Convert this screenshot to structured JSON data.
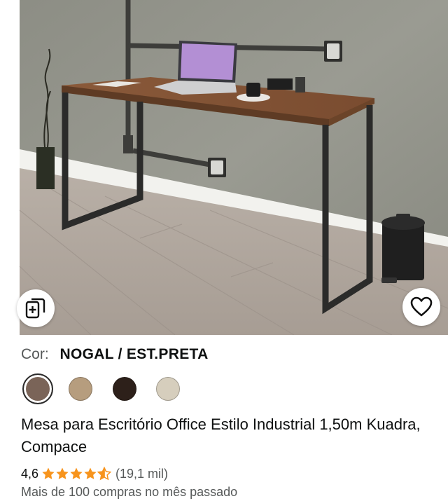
{
  "product": {
    "image_alt": "Mesa de escritório industrial",
    "color_label": "Cor:",
    "color_value": "NOGAL / EST.PRETA",
    "swatches": [
      {
        "name": "nogal",
        "color": "#7a6458",
        "selected": true
      },
      {
        "name": "castanho-claro",
        "color": "#b69d7e",
        "selected": false
      },
      {
        "name": "preto",
        "color": "#2d201a",
        "selected": false
      },
      {
        "name": "bege",
        "color": "#d6cebd",
        "selected": false
      }
    ],
    "title": "Mesa para Escritório Office Estilo Industrial 1,50m Kuadra, Compace",
    "rating": "4,6",
    "rating_value": 4.6,
    "rating_count": "(19,1 mil)",
    "purchases": "Mais de 100 compras no mês passado"
  },
  "icons": {
    "compare": "compare-icon",
    "wishlist": "heart-icon",
    "star": "star-icon"
  },
  "colors": {
    "star": "#f7941d",
    "text": "#0f1111",
    "muted": "#565959"
  }
}
